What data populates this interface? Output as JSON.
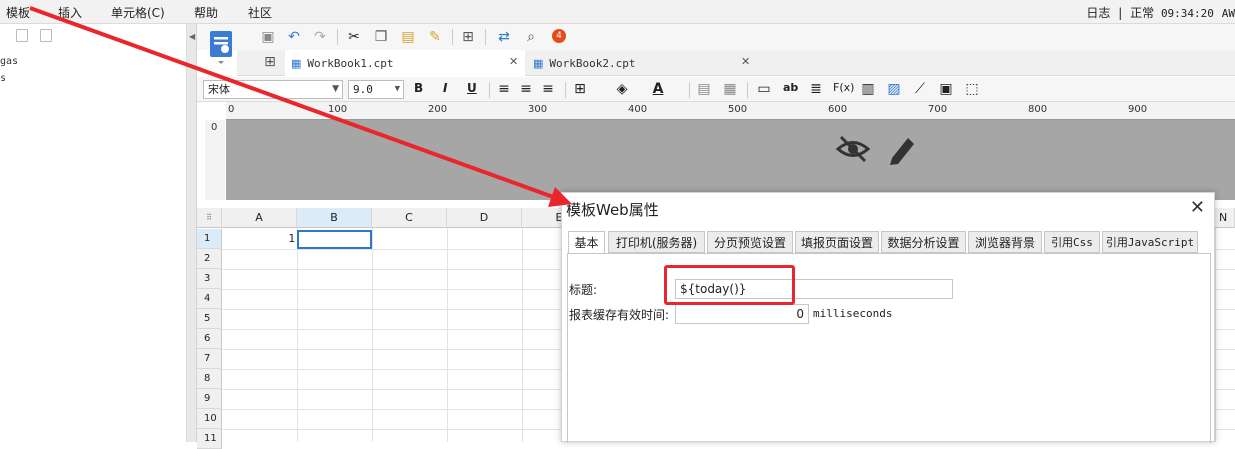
{
  "menu": {
    "items": [
      "模板",
      "插入",
      "单元格(C)",
      "帮助",
      "社区"
    ]
  },
  "status": {
    "log_label": "日志",
    "separator": "|",
    "state": "正常",
    "time": "09:34:20",
    "suffix": "AW"
  },
  "left_panel": {
    "items": [
      "gas",
      "s"
    ]
  },
  "toolbar": {
    "badge": "4"
  },
  "workbook_tabs": [
    {
      "label": "WorkBook1.cpt",
      "active": true
    },
    {
      "label": "WorkBook2.cpt",
      "active": false
    }
  ],
  "format_bar": {
    "font_family": "宋体",
    "font_size": "9.0",
    "bold": "B",
    "italic": "I",
    "underline": "U",
    "text_ab": "ab",
    "fx": "F(x)"
  },
  "ruler": {
    "ticks": [
      "0",
      "100",
      "200",
      "300",
      "400",
      "500",
      "600",
      "700",
      "800",
      "900"
    ]
  },
  "grid": {
    "columns": [
      "A",
      "B",
      "C",
      "D",
      "E"
    ],
    "rows": [
      "1",
      "2",
      "3",
      "4",
      "5",
      "6",
      "7",
      "8",
      "9",
      "10",
      "11"
    ],
    "cell_A1": "1",
    "right_col_hint": "N"
  },
  "dialog": {
    "title": "模板Web属性",
    "tabs": [
      "基本",
      "打印机(服务器)",
      "分页预览设置",
      "填报页面设置",
      "数据分析设置",
      "浏览器背景",
      "引用Css",
      "引用JavaScript"
    ],
    "active_tab": "基本",
    "title_label": "标题:",
    "title_value": "${today()}",
    "cache_label": "报表缓存有效时间:",
    "cache_value": "0",
    "cache_unit": "milliseconds"
  },
  "colors": {
    "annotation_red": "#e8262c",
    "selection_blue": "#2b77d1",
    "canvas_gray": "#a6a6a6"
  }
}
